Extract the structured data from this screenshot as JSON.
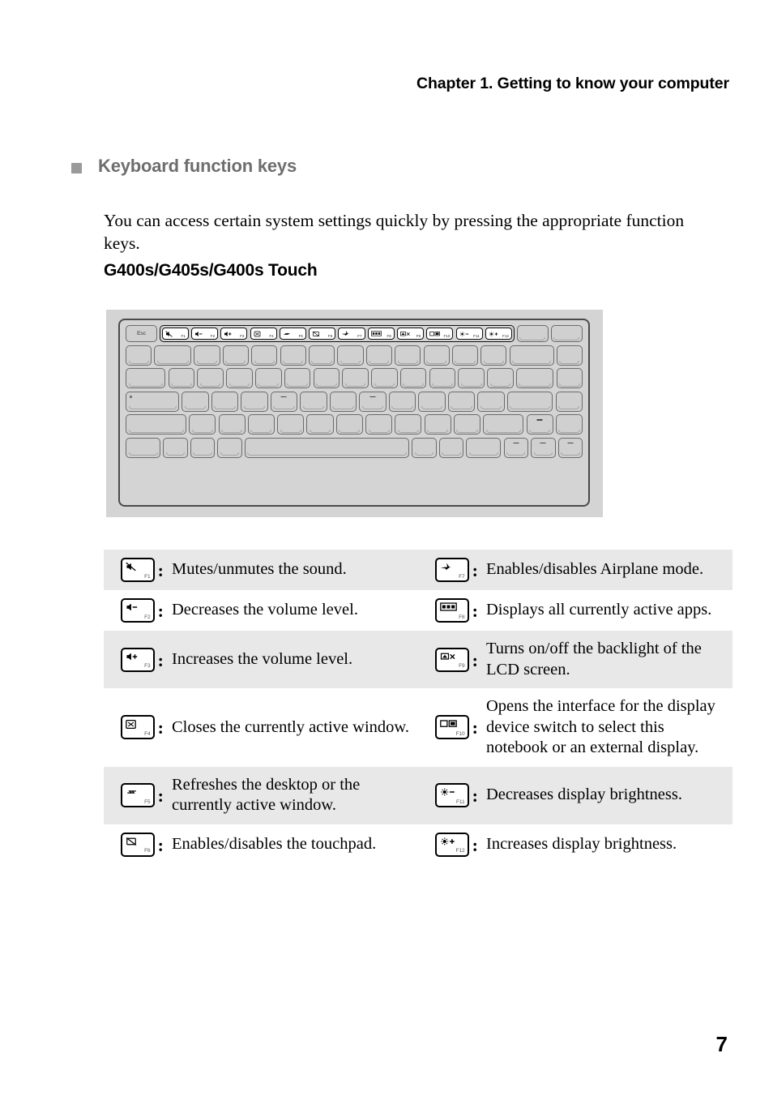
{
  "header": {
    "chapter_title": "Chapter 1. Getting to know your computer"
  },
  "section": {
    "bullet": "square-bullet",
    "title": "Keyboard function keys",
    "intro": "You can access certain system settings quickly by pressing the appropriate function keys.",
    "model_subtitle": "G400s/G405s/G400s Touch"
  },
  "keyboard_figure": {
    "esc_label": "Esc",
    "function_keys": [
      {
        "label": "F1",
        "icon": "mute-icon"
      },
      {
        "label": "F2",
        "icon": "volume-down-icon"
      },
      {
        "label": "F3",
        "icon": "volume-up-icon"
      },
      {
        "label": "F4",
        "icon": "close-window-icon"
      },
      {
        "label": "F5",
        "icon": "refresh-icon"
      },
      {
        "label": "F6",
        "icon": "touchpad-toggle-icon"
      },
      {
        "label": "F7",
        "icon": "airplane-mode-icon"
      },
      {
        "label": "F8",
        "icon": "active-apps-icon"
      },
      {
        "label": "F9",
        "icon": "lcd-backlight-icon"
      },
      {
        "label": "F10",
        "icon": "display-switch-icon"
      },
      {
        "label": "F11",
        "icon": "brightness-down-icon"
      },
      {
        "label": "F12",
        "icon": "brightness-up-icon"
      }
    ]
  },
  "fn_table": {
    "rows": [
      {
        "shaded": true,
        "left": {
          "key_label": "F1",
          "icon": "mute-icon",
          "description": "Mutes/unmutes the sound."
        },
        "right": {
          "key_label": "F7",
          "icon": "airplane-mode-icon",
          "description": "Enables/disables Airplane mode."
        }
      },
      {
        "shaded": false,
        "left": {
          "key_label": "F2",
          "icon": "volume-down-icon",
          "description": "Decreases the volume level."
        },
        "right": {
          "key_label": "F8",
          "icon": "active-apps-icon",
          "description": "Displays all currently active apps."
        }
      },
      {
        "shaded": true,
        "left": {
          "key_label": "F3",
          "icon": "volume-up-icon",
          "description": "Increases the volume level."
        },
        "right": {
          "key_label": "F9",
          "icon": "lcd-backlight-icon",
          "description": "Turns on/off the backlight of the LCD screen."
        }
      },
      {
        "shaded": false,
        "left": {
          "key_label": "F4",
          "icon": "close-window-icon",
          "description": "Closes the currently active window."
        },
        "right": {
          "key_label": "F10",
          "icon": "display-switch-icon",
          "description": "Opens the interface for the display device switch to select this notebook or an external display."
        }
      },
      {
        "shaded": true,
        "left": {
          "key_label": "F5",
          "icon": "refresh-icon",
          "description": "Refreshes the desktop or the currently active window."
        },
        "right": {
          "key_label": "F11",
          "icon": "brightness-down-icon",
          "description": "Decreases display brightness."
        }
      },
      {
        "shaded": false,
        "left": {
          "key_label": "F6",
          "icon": "touchpad-toggle-icon",
          "description": "Enables/disables the touchpad."
        },
        "right": {
          "key_label": "F12",
          "icon": "brightness-up-icon",
          "description": "Increases display brightness."
        }
      }
    ],
    "separator": ":"
  },
  "footer": {
    "page_number": "7"
  },
  "colors": {
    "heading_gray": "#6e6e6e",
    "bullet_gray": "#9a9a9a",
    "row_shade": "#e8e8e8",
    "keyboard_bg": "#d4d4d4",
    "key_fill": "#d0d0d0",
    "text": "#000000"
  }
}
